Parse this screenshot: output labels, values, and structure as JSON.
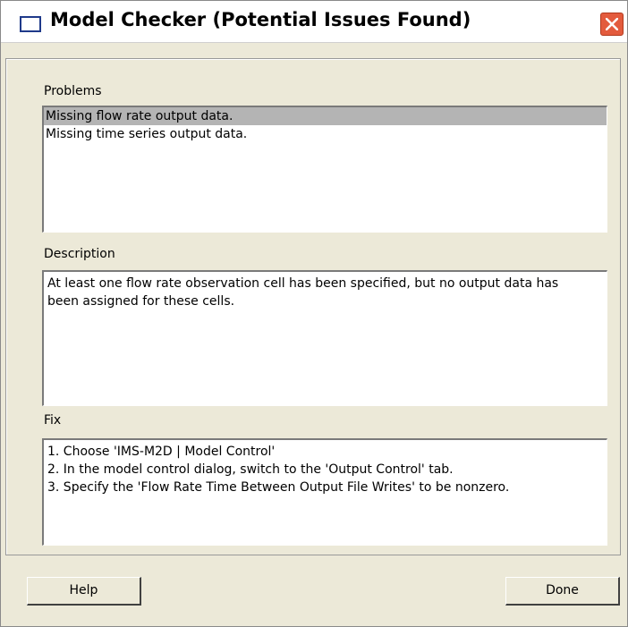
{
  "window": {
    "title": "Model Checker (Potential Issues Found)",
    "icon": "window-icon",
    "close_icon": "close-icon"
  },
  "problems": {
    "label": "Problems",
    "items": [
      {
        "text": "Missing flow rate output data.",
        "selected": true
      },
      {
        "text": "Missing time series output data.",
        "selected": false
      }
    ]
  },
  "description": {
    "label": "Description",
    "text": "At least one flow rate observation cell has been specified, but no output data has been assigned for these cells."
  },
  "fix": {
    "label": "Fix",
    "lines": [
      "1. Choose 'IMS-M2D | Model Control'",
      "2. In the model control dialog, switch to the 'Output Control' tab.",
      "3. Specify the 'Flow Rate Time Between Output File Writes' to be nonzero."
    ]
  },
  "buttons": {
    "help": "Help",
    "done": "Done"
  },
  "colors": {
    "dialog_bg": "#ece9d8",
    "selection": "#b4b4b4",
    "close_button": "#e35b3d"
  }
}
